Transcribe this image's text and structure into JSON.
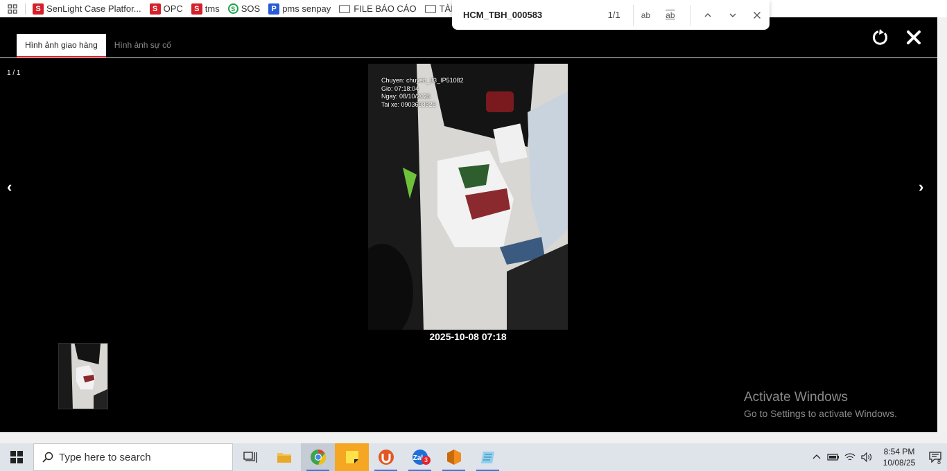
{
  "bookmarks": {
    "items": [
      {
        "label": "SenLight Case Platfor...",
        "icon": "senlight-icon"
      },
      {
        "label": "OPC",
        "icon": "senlight-icon"
      },
      {
        "label": "tms",
        "icon": "senlight-icon"
      },
      {
        "label": "SOS",
        "icon": "sos-icon"
      },
      {
        "label": "pms senpay",
        "icon": "p-icon"
      },
      {
        "label": "FILE BÁO CÁO",
        "icon": "folder-icon"
      },
      {
        "label": "TÀI LIỆU",
        "icon": "folder-icon"
      }
    ]
  },
  "find": {
    "query": "HCM_TBH_000583",
    "count": "1/1",
    "match_case_label": "ab",
    "whole_word_label": "ab"
  },
  "viewer": {
    "tabs": [
      {
        "label": "Hình ảnh giao hàng",
        "active": true
      },
      {
        "label": "Hình ảnh sự cố",
        "active": false
      }
    ],
    "counter": "1 / 1",
    "prev_label": "‹",
    "next_label": "›",
    "photo_overlay": {
      "line1": "Chuyen: chuyen_33_IP51082",
      "line2": "Gio: 07:18:04",
      "line3": "Ngay: 08/10/2025",
      "line4": "Tai xe: 0903693322"
    },
    "caption": "2025-10-08 07:18"
  },
  "watermark": {
    "title": "Activate Windows",
    "subtitle": "Go to Settings to activate Windows."
  },
  "taskbar": {
    "search_placeholder": "Type here to search",
    "zalo_badge": "3",
    "time": "8:54 PM",
    "date": "10/08/25",
    "notification_count": "8"
  },
  "colors": {
    "accent_red": "#d4202a",
    "viewer_bg": "#000000",
    "taskbar_bg": "#dfe3ea"
  }
}
